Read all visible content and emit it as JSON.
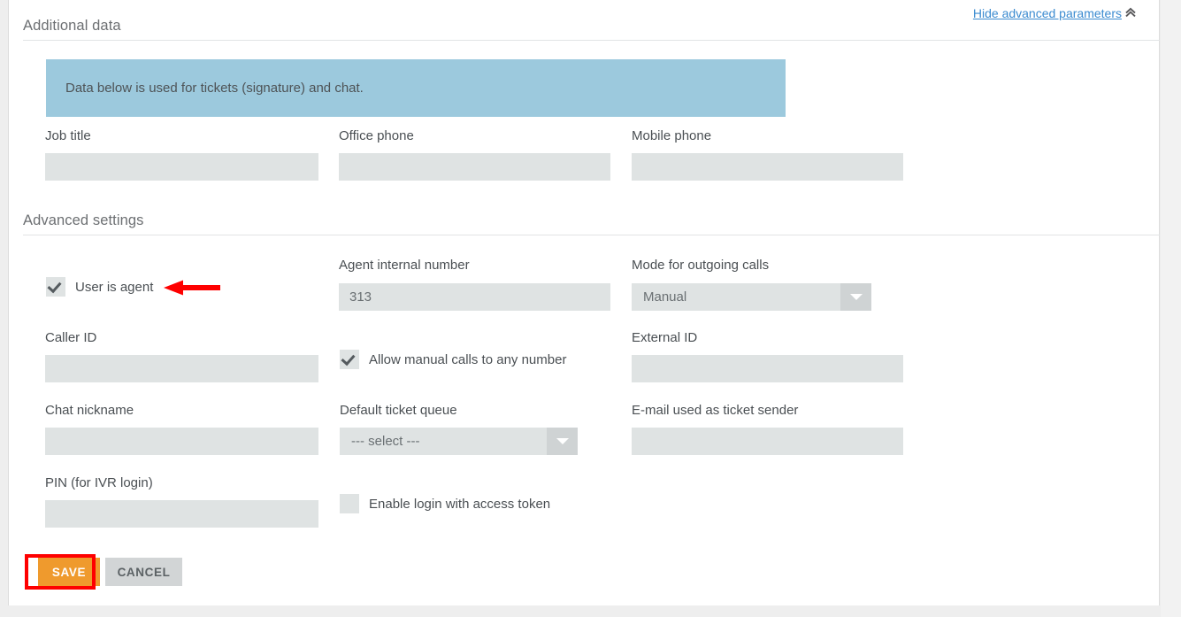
{
  "header": {
    "additional_data_title": "Additional data",
    "advanced_settings_title": "Advanced settings",
    "advanced_params_link": "Hide advanced parameters",
    "advanced_params_icon": "double-chevron-up-icon"
  },
  "banner": {
    "text": "Data below is used for tickets (signature) and chat.",
    "background_color": "#9cc9dd"
  },
  "additional_data": {
    "fields": [
      {
        "label": "Job title",
        "value": "",
        "placeholder": ""
      },
      {
        "label": "Office phone",
        "value": "",
        "placeholder": ""
      },
      {
        "label": "Mobile phone",
        "value": "",
        "placeholder": ""
      }
    ]
  },
  "advanced_settings": {
    "user_is_agent": {
      "label": "User is agent",
      "checked": true
    },
    "agent_internal_number": {
      "label": "Agent internal number",
      "value": "313",
      "placeholder": ""
    },
    "mode_for_outgoing_calls": {
      "label": "Mode for outgoing calls",
      "selected": "Manual",
      "options": [
        "Manual"
      ],
      "icon": "chevron-down-icon"
    },
    "caller_id": {
      "label": "Caller ID",
      "value": "",
      "placeholder": ""
    },
    "allow_manual_calls": {
      "label": "Allow manual calls to any number",
      "checked": true
    },
    "external_id": {
      "label": "External ID",
      "value": "",
      "placeholder": ""
    },
    "chat_nickname": {
      "label": "Chat nickname",
      "value": "",
      "placeholder": ""
    },
    "default_ticket_queue": {
      "label": "Default ticket queue",
      "selected": "--- select ---",
      "options": [
        "--- select ---"
      ],
      "icon": "chevron-down-icon"
    },
    "email_ticket_sender": {
      "label": "E-mail used as ticket sender",
      "value": "",
      "placeholder": ""
    },
    "pin_ivr_login": {
      "label": "PIN (for IVR login)",
      "value": "",
      "placeholder": ""
    },
    "enable_access_token": {
      "label": "Enable login with access token",
      "checked": false
    }
  },
  "actions": {
    "save_label": "SAVE",
    "cancel_label": "CANCEL",
    "save_color": "#ef9a2d",
    "cancel_color": "#d2d5d6"
  },
  "annotations": {
    "highlight_color": "#fe0000",
    "arrow_target": "user-is-agent-checkbox",
    "highlight_target": "save-button"
  }
}
